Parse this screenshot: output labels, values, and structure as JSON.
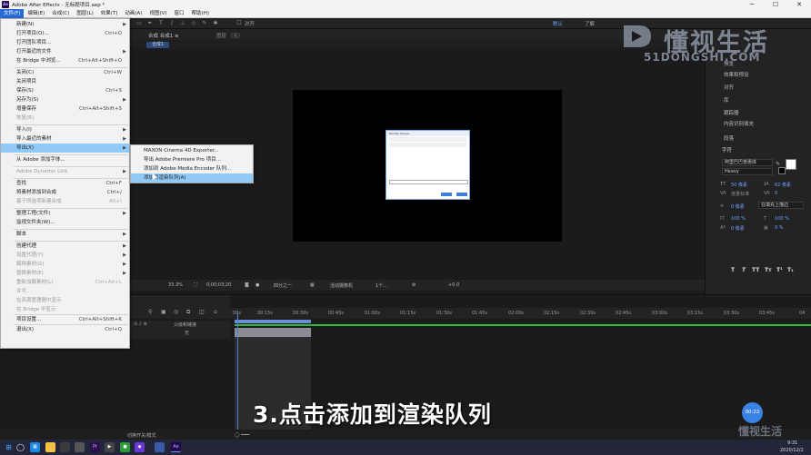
{
  "window": {
    "title": "Adobe After Effects - 无标题项目.aep *",
    "minimize": "─",
    "maximize": "☐",
    "close": "✕"
  },
  "menubar": [
    "文件(F)",
    "编辑(E)",
    "合成(C)",
    "图层(L)",
    "效果(T)",
    "动画(A)",
    "视图(V)",
    "窗口",
    "帮助(H)"
  ],
  "toolbar": {
    "align_label": "对齐",
    "workspace_tabs": [
      "默认",
      "了解"
    ]
  },
  "comp_panel": {
    "tab_label": "合成 合成1 ≡",
    "layer_tab": "图层 （无）",
    "sub_tab": "合成1",
    "viewer": {
      "zoom": "33.3%",
      "time": "0;00;03;20",
      "resolution": "四分之一",
      "camera": "活动摄像机",
      "views": "1个...",
      "exposure": "+0.0"
    },
    "mini_window_title": "Render Queue..."
  },
  "right_panel": {
    "items": [
      "预览",
      "效果和预设",
      "对齐",
      "库",
      "跟踪器",
      "内容识别填充",
      "段落",
      "字符"
    ],
    "font_family": "阿里巴巴普惠体",
    "font_style": "Heavy",
    "size_value": "50 像素",
    "leading_value": "62 像素",
    "kerning": "度量标准",
    "tracking": "0",
    "stroke_width": "0 像素",
    "stroke_type": "在填充上描边",
    "vscale": "100 %",
    "hscale": "100 %",
    "baseline": "0 像素",
    "tsume": "0 %",
    "styles": [
      "T",
      "T",
      "TT",
      "Tт",
      "T¹",
      "T₁"
    ]
  },
  "file_menu": [
    {
      "label": "新建(N)",
      "shortcut": "",
      "arrow": true,
      "disabled": false
    },
    {
      "label": "打开项目(O)...",
      "shortcut": "Ctrl+O",
      "arrow": false,
      "disabled": false
    },
    {
      "label": "打开团队项目...",
      "shortcut": "",
      "arrow": false,
      "disabled": false
    },
    {
      "label": "打开最近的文件",
      "shortcut": "",
      "arrow": true,
      "disabled": false
    },
    {
      "label": "在 Bridge 中浏览...",
      "shortcut": "Ctrl+Alt+Shift+O",
      "arrow": false,
      "disabled": false
    },
    {
      "label": "关闭(C)",
      "shortcut": "Ctrl+W",
      "arrow": false,
      "disabled": false
    },
    {
      "label": "关闭项目",
      "shortcut": "",
      "arrow": false,
      "disabled": false
    },
    {
      "label": "保存(S)",
      "shortcut": "Ctrl+S",
      "arrow": false,
      "disabled": false
    },
    {
      "label": "另存为(S)",
      "shortcut": "",
      "arrow": true,
      "disabled": false
    },
    {
      "label": "增量保存",
      "shortcut": "Ctrl+Alt+Shift+S",
      "arrow": false,
      "disabled": false
    },
    {
      "label": "恢复(R)",
      "shortcut": "",
      "arrow": false,
      "disabled": true
    },
    {
      "label": "导入(I)",
      "shortcut": "",
      "arrow": true,
      "disabled": false
    },
    {
      "label": "导入最近的素材",
      "shortcut": "",
      "arrow": true,
      "disabled": false
    },
    {
      "label": "导出(X)",
      "shortcut": "",
      "arrow": true,
      "disabled": false
    },
    {
      "label": "从 Adobe 添加字体...",
      "shortcut": "",
      "arrow": false,
      "disabled": false
    },
    {
      "label": "Adobe Dynamic Link",
      "shortcut": "",
      "arrow": true,
      "disabled": true
    },
    {
      "label": "查找",
      "shortcut": "Ctrl+F",
      "arrow": false,
      "disabled": false
    },
    {
      "label": "将素材添加到合成",
      "shortcut": "Ctrl+/",
      "arrow": false,
      "disabled": false
    },
    {
      "label": "基于所选项新建合成",
      "shortcut": "Alt+\\",
      "arrow": false,
      "disabled": true
    },
    {
      "label": "整理工程(文件)",
      "shortcut": "",
      "arrow": true,
      "disabled": false
    },
    {
      "label": "监视文件夹(W)...",
      "shortcut": "",
      "arrow": false,
      "disabled": false
    },
    {
      "label": "脚本",
      "shortcut": "",
      "arrow": true,
      "disabled": false
    },
    {
      "label": "创建代理",
      "shortcut": "",
      "arrow": true,
      "disabled": false
    },
    {
      "label": "设置代理(Y)",
      "shortcut": "",
      "arrow": true,
      "disabled": true
    },
    {
      "label": "解释素材(G)",
      "shortcut": "",
      "arrow": true,
      "disabled": true
    },
    {
      "label": "替换素材(E)",
      "shortcut": "",
      "arrow": true,
      "disabled": true
    },
    {
      "label": "重新加载素材(L)",
      "shortcut": "Ctrl+Alt+L",
      "arrow": false,
      "disabled": true
    },
    {
      "label": "许可...",
      "shortcut": "",
      "arrow": false,
      "disabled": true
    },
    {
      "label": "在资源管理器中显示",
      "shortcut": "",
      "arrow": false,
      "disabled": true
    },
    {
      "label": "在 Bridge 中显示",
      "shortcut": "",
      "arrow": false,
      "disabled": true
    },
    {
      "label": "项目设置...",
      "shortcut": "Ctrl+Alt+Shift+K",
      "arrow": false,
      "disabled": false
    },
    {
      "label": "退出(X)",
      "shortcut": "Ctrl+Q",
      "arrow": false,
      "disabled": false
    }
  ],
  "export_submenu": [
    "MAXON Cinema 4D Exporter...",
    "导出 Adobe Premiere Pro 项目...",
    "添加到 Adobe Media Encoder 队列...",
    "添加到渲染队列(A)"
  ],
  "timeline": {
    "ticks": [
      "00s",
      "00:15s",
      "00:30s",
      "00:45s",
      "01:00s",
      "01:15s",
      "01:30s",
      "01:45s",
      "02:00s",
      "02:15s",
      "02:30s",
      "02:45s",
      "03:00s",
      "03:15s",
      "03:30s",
      "03:45s",
      "04"
    ],
    "parent_col": "父级和链接",
    "parent_value": "无",
    "bottom_label": "切换开关/模式"
  },
  "caption": "3.点击添加到渲染队列",
  "timer": "00:22",
  "watermark": {
    "big": "懂视生活",
    "small": "51DONGSHI.COM",
    "corner": "懂视生活"
  },
  "taskbar": {
    "icons": [
      "⊞",
      "◯",
      "▦",
      "🗀",
      "Pr",
      "▶",
      "●",
      "◆",
      "Ae"
    ],
    "time": "9:31",
    "date": "2020/12/2"
  },
  "colors": {
    "menu_highlight": "#91c9f7",
    "menubar_active": "#2a6cd6",
    "accent_blue": "#6aa4ff",
    "green_line": "#2fbb3a"
  }
}
